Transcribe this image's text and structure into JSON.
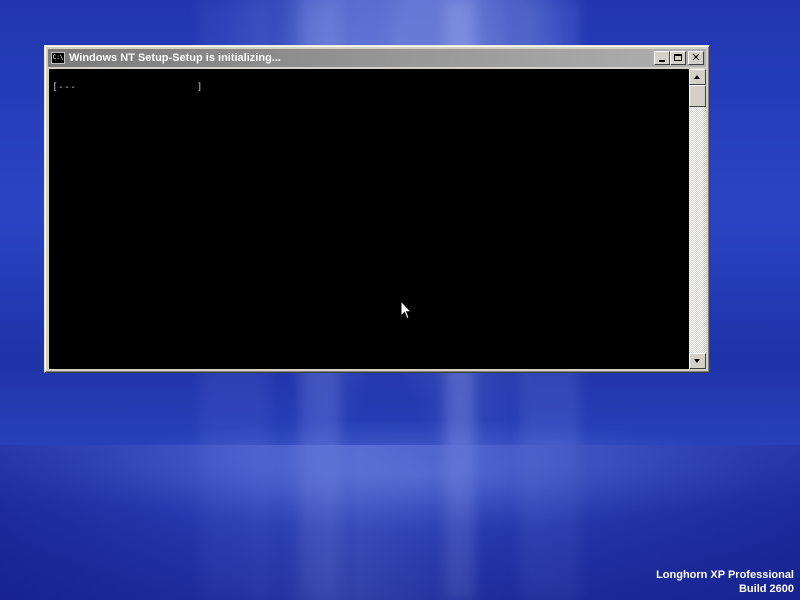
{
  "window": {
    "title": "Windows NT Setup-Setup is initializing...",
    "icon": "console-icon",
    "icon_text": "C:\\",
    "buttons": {
      "minimize": "minimize-icon",
      "maximize": "maximize-icon",
      "close_glyph": "✕"
    }
  },
  "console": {
    "progress_text": "[---                    ]"
  },
  "watermark": {
    "line1": "Longhorn XP Professional",
    "line2": "Build 2600"
  },
  "colors": {
    "desktop_blue": "#2a44c4",
    "console_bg": "#000000",
    "console_text": "#c0c0c0",
    "titlebar_inactive": "#808080"
  }
}
